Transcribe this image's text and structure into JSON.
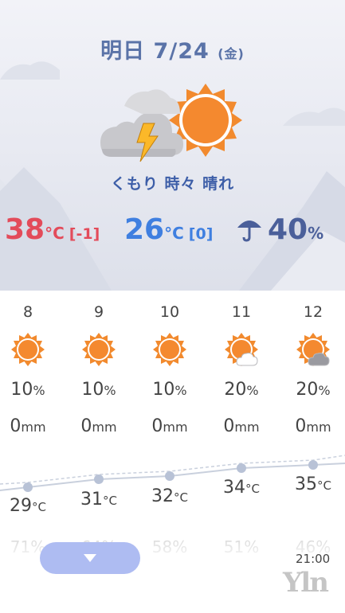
{
  "header": {
    "date": "明日 7/24",
    "weekday": "(金)",
    "icon": "cloud-lightning-sun-icon",
    "condition": "くもり 時々 晴れ"
  },
  "summary": {
    "high_value": "38",
    "high_unit": "°C",
    "high_delta": "[-1]",
    "low_value": "26",
    "low_unit": "°C",
    "low_delta": "[0]",
    "rain_icon": "umbrella-icon",
    "rain_value": "40",
    "rain_unit": "%"
  },
  "units": {
    "pct": "%",
    "mm": "mm",
    "deg": "°C"
  },
  "hourly": [
    {
      "hour": "8",
      "icon": "sun-icon",
      "pct": "10",
      "mm": "0",
      "temp": "29",
      "humidity": "71%"
    },
    {
      "hour": "9",
      "icon": "sun-icon",
      "pct": "10",
      "mm": "0",
      "temp": "31",
      "humidity": "64%"
    },
    {
      "hour": "10",
      "icon": "sun-icon",
      "pct": "10",
      "mm": "0",
      "temp": "32",
      "humidity": "58%"
    },
    {
      "hour": "11",
      "icon": "sun-cloud-icon",
      "pct": "20",
      "mm": "0",
      "temp": "34",
      "humidity": "51%"
    },
    {
      "hour": "12",
      "icon": "sun-cloud-icon",
      "pct": "20",
      "mm": "0",
      "temp": "35",
      "humidity": "46%"
    }
  ],
  "footer": {
    "expand_icon": "triangle-down-icon",
    "time": "21:00",
    "logo": "Yln"
  },
  "colors": {
    "high": "#e34b5a",
    "low": "#3f7fe0",
    "title": "#5a73a8",
    "accent": "#f28a2e"
  }
}
